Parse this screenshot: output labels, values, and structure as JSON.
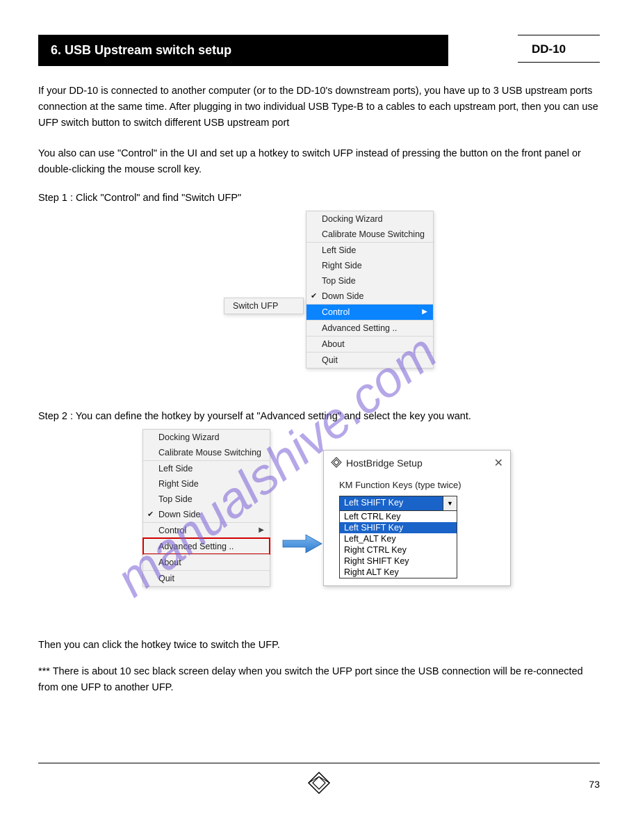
{
  "header": {
    "section_title": "6. USB Upstream switch setup",
    "model": "DD-10"
  },
  "intro": "If your DD-10 is connected to another computer (or to the DD-10's downstream ports), you have up to 3 USB upstream ports connection at the same time. After plugging in two individual USB Type-B to a cables to each upstream port, then you can use UFP switch button to switch different USB upstream port",
  "control_intro": "You also can use \"Control\" in the UI and set up a hotkey to switch UFP instead of pressing the button on the front panel or double-clicking the mouse scroll key.",
  "step1": "Step 1 : Click \"Control\" and find \"Switch UFP\"",
  "step2": "Step 2 : You can define the hotkey by yourself at \"Advanced setting\" and select the key you want.",
  "menu1": {
    "switch_ufp": "Switch UFP",
    "items": {
      "docking_wizard": "Docking Wizard",
      "calibrate": "Calibrate Mouse Switching",
      "left": "Left Side",
      "right": "Right Side",
      "top": "Top Side",
      "down": "Down Side",
      "control": "Control",
      "advanced": "Advanced Setting ..",
      "about": "About",
      "quit": "Quit"
    }
  },
  "menu2": {
    "items": {
      "docking_wizard": "Docking Wizard",
      "calibrate": "Calibrate Mouse Switching",
      "left": "Left Side",
      "right": "Right Side",
      "top": "Top Side",
      "down": "Down Side",
      "control": "Control",
      "advanced": "Advanced Setting ..",
      "about": "About",
      "quit": "Quit"
    }
  },
  "dialog": {
    "title": "HostBridge Setup",
    "label": "KM Function Keys (type twice)",
    "selected": "Left SHIFT Key",
    "options": {
      "o1": "Left CTRL Key",
      "o2": "Left SHIFT Key",
      "o3": "Left_ALT Key",
      "o4": "Right CTRL Key",
      "o5": "Right SHIFT Key",
      "o6": "Right ALT Key"
    }
  },
  "closing": {
    "p1": "Then you can click the hotkey twice to switch the UFP.",
    "p2": "*** There is about 10 sec black screen delay when you switch the UFP port since the USB connection will be re-connected from one UFP to another UFP."
  },
  "watermark": "manualshive.com",
  "page": "73"
}
